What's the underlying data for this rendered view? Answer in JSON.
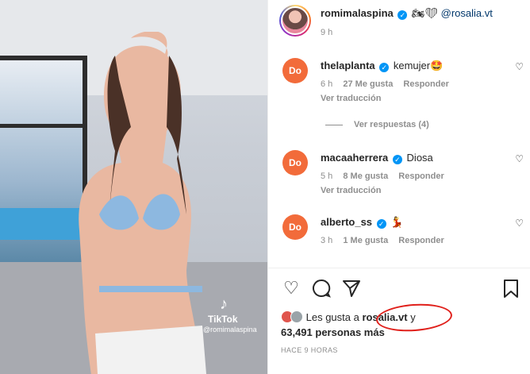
{
  "media": {
    "tiktok_logo": "TikTok",
    "tiktok_user": "@romimalaspina"
  },
  "post": {
    "author": "romimalaspina",
    "author_extras": "🏍❤",
    "mention": "@rosalia.vt",
    "time": "9 h"
  },
  "comments": [
    {
      "avatar_text": "Do",
      "user": "thelaplanta",
      "text": "kemujer🤩",
      "time": "6 h",
      "likes": "27 Me gusta",
      "reply": "Responder",
      "translate": "Ver traducción"
    },
    {
      "avatar_text": "Do",
      "user": "macaaherrera",
      "text": "Diosa",
      "time": "5 h",
      "likes": "8 Me gusta",
      "reply": "Responder",
      "translate": "Ver traducción"
    },
    {
      "avatar_text": "Do",
      "user": "alberto_ss",
      "text": "💃",
      "time": "3 h",
      "likes": "1 Me gusta",
      "reply": "Responder"
    }
  ],
  "view_replies": "Ver respuestas (4)",
  "likes": {
    "prefix": "Les gusta a",
    "user": "rosalia.vt",
    "suffix": "y",
    "total": "63,491 personas más"
  },
  "ago": "HACE 9 HORAS",
  "icons": {
    "verified": "✓",
    "heart_small": "♡",
    "like": "♡",
    "comment": "◯",
    "share": "➢",
    "save": "🔖"
  }
}
